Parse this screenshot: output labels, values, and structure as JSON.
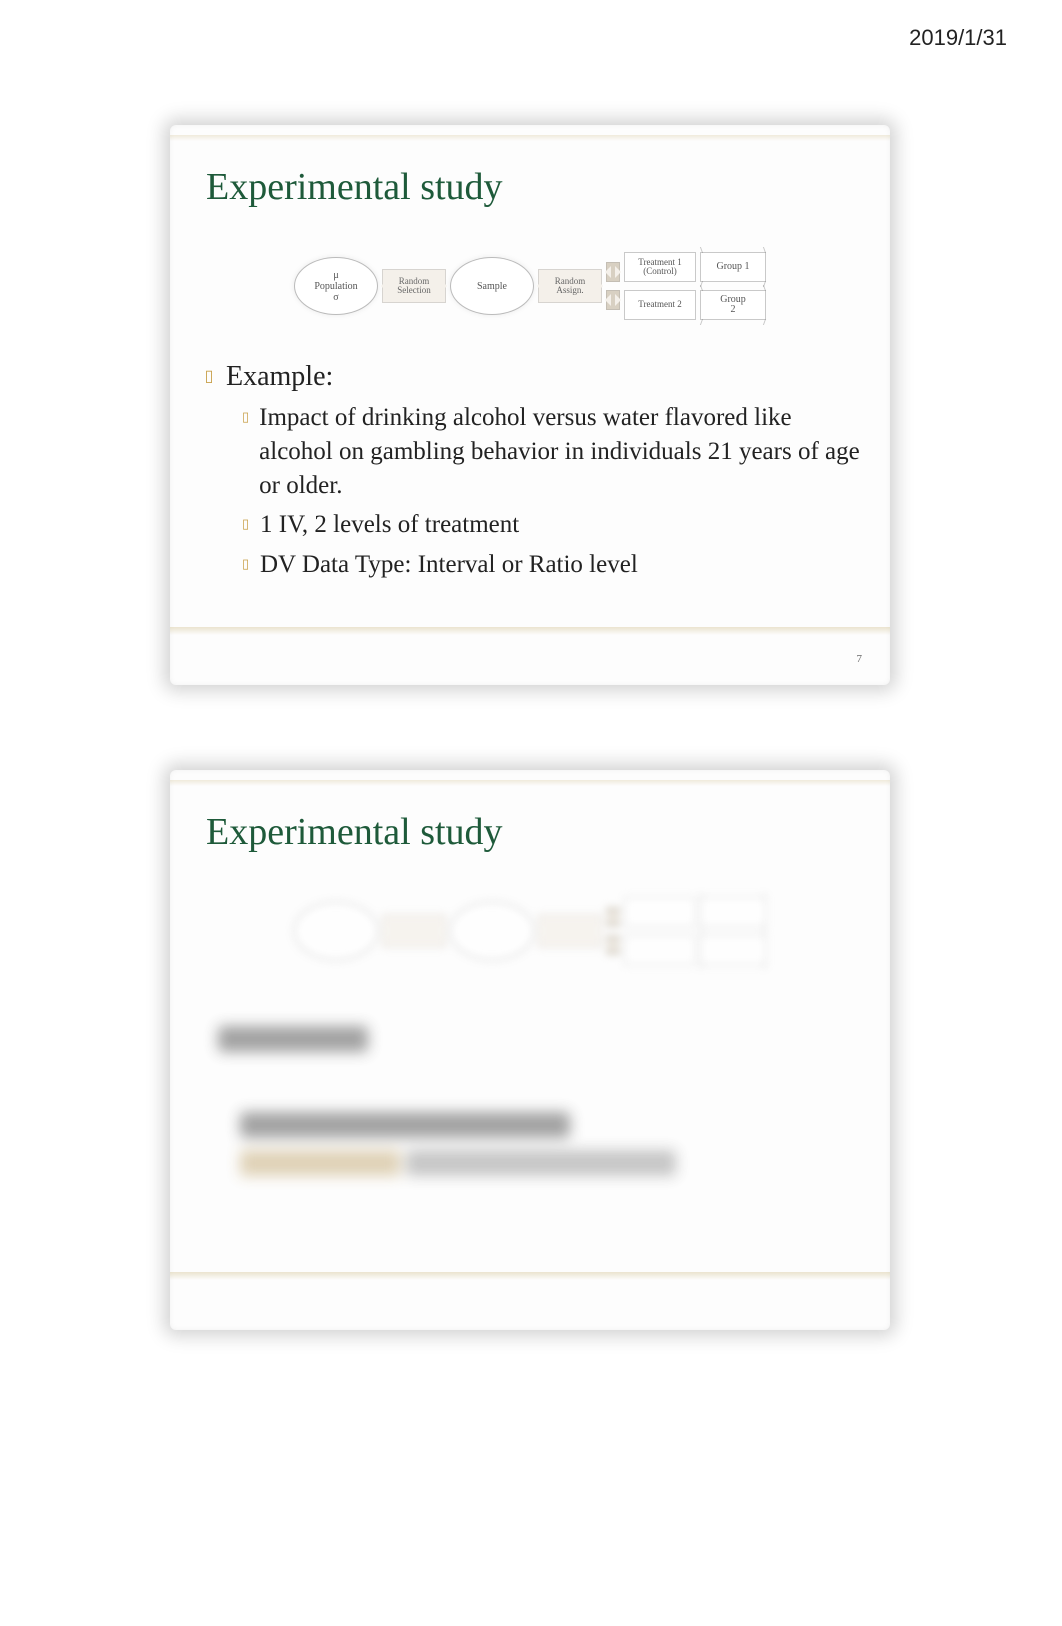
{
  "date": "2019/1/31",
  "slide1": {
    "title": "Experimental study",
    "number": "7",
    "flow": {
      "population_mu": "μ",
      "population": "Population",
      "population_sigma": "σ",
      "random_selection": "Random",
      "random_selection2": "Selection",
      "sample": "Sample",
      "random_assign": "Random",
      "random_assign2": "Assign.",
      "treatment1a": "Treatment 1",
      "treatment1b": "(Control)",
      "treatment2": "Treatment 2",
      "group1": "Group 1",
      "group2a": "Group",
      "group2b": "2"
    },
    "example_label": "Example:",
    "bullets": [
      "Impact of drinking alcohol versus water flavored like alcohol on gambling behavior in individuals 21 years of age or older.",
      "1 IV, 2 levels of treatment",
      "DV Data Type: Interval or Ratio level"
    ]
  },
  "slide2": {
    "title": "Experimental study"
  }
}
